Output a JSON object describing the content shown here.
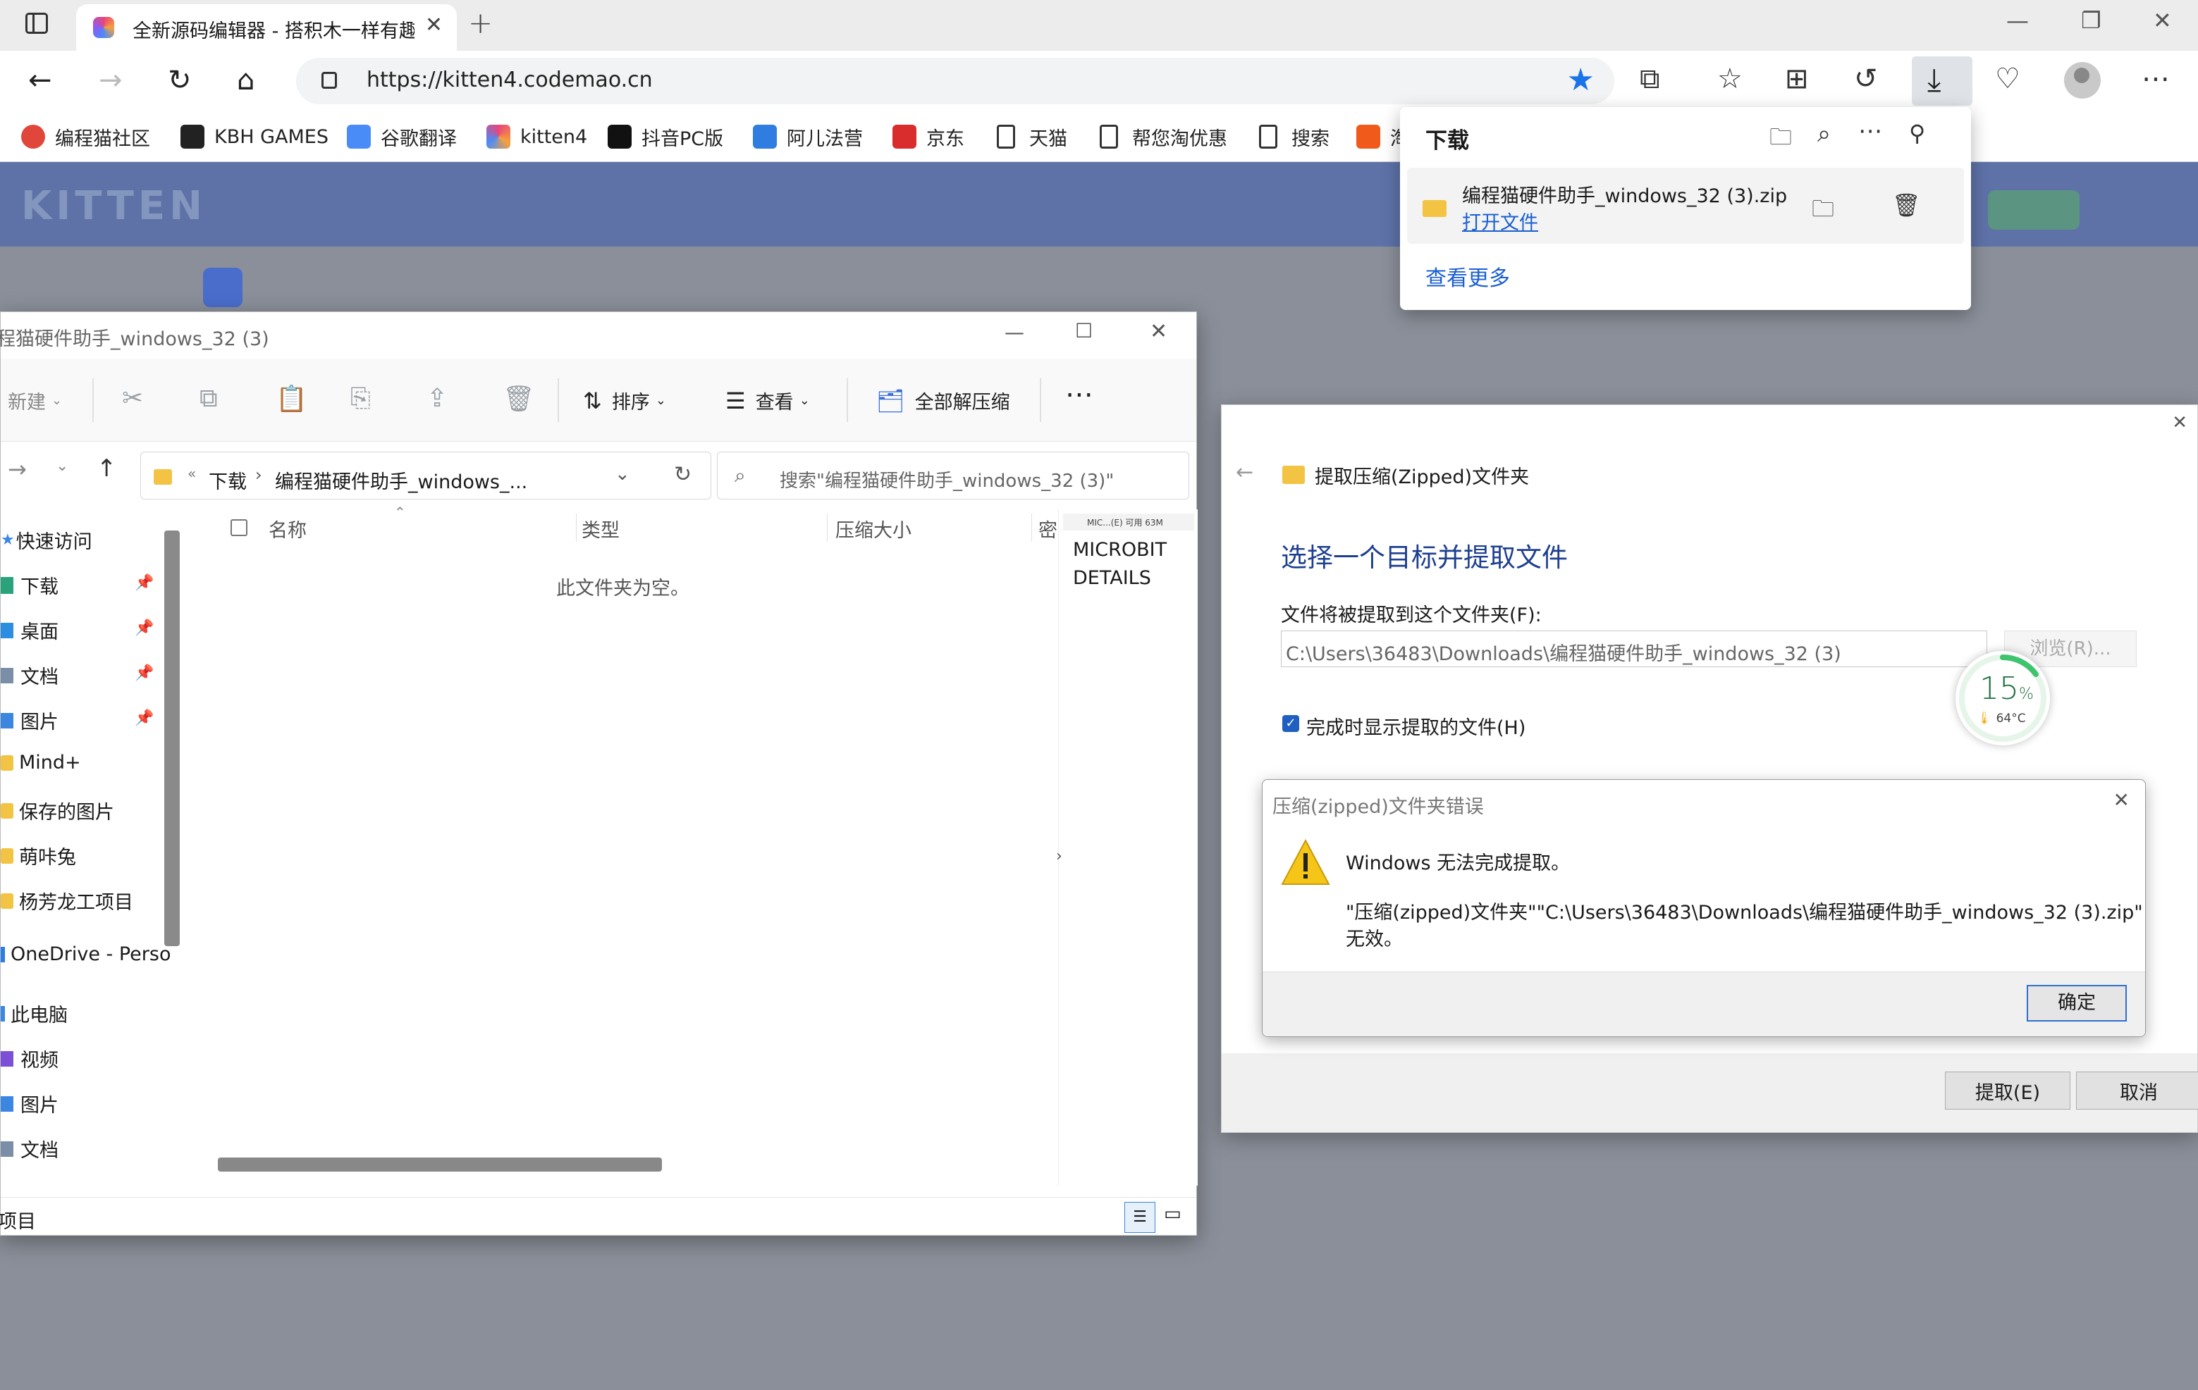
{
  "browser": {
    "tab_title": "全新源码编辑器 - 搭积木一样有趣",
    "url": "https://kitten4.codemao.cn",
    "bookmarks": [
      {
        "label": "编程猫社区",
        "color": "#e0463a"
      },
      {
        "label": "KBH GAMES",
        "color": "#222222"
      },
      {
        "label": "谷歌翻译",
        "color": "#4a8cf7"
      },
      {
        "label": "kitten4",
        "color": "#d946a8"
      },
      {
        "label": "抖音PC版",
        "color": "#111111"
      },
      {
        "label": "阿儿法营",
        "color": "#2f7de1"
      },
      {
        "label": "京东",
        "color": "#d92d2d"
      },
      {
        "label": "天猫",
        "color": "file"
      },
      {
        "label": "帮您淘优惠",
        "color": "file"
      },
      {
        "label": "搜索",
        "color": "file"
      },
      {
        "label": "淘",
        "color": "#f05a1a"
      }
    ]
  },
  "download_flyout": {
    "title": "下载",
    "file_name": "编程猫硬件助手_windows_32 (3).zip",
    "open_link": "打开文件",
    "see_more": "查看更多"
  },
  "explorer": {
    "title": "程猫硬件助手_windows_32 (3)",
    "toolbar": {
      "new": "新建",
      "sort": "排序",
      "view": "查看",
      "extract_all": "全部解压缩"
    },
    "breadcrumb": [
      "下载",
      "编程猫硬件助手_windows_..."
    ],
    "search_placeholder": "搜索\"编程猫硬件助手_windows_32 (3)\"",
    "sidebar": [
      {
        "label": "快速访问",
        "icon": "star-icon",
        "pinned": false
      },
      {
        "label": "下载",
        "icon": "download-icon",
        "pinned": true
      },
      {
        "label": "桌面",
        "icon": "desktop-icon",
        "pinned": true
      },
      {
        "label": "文档",
        "icon": "document-icon",
        "pinned": true
      },
      {
        "label": "图片",
        "icon": "picture-icon",
        "pinned": true
      },
      {
        "label": "Mind+",
        "icon": "folder-icon",
        "pinned": false
      },
      {
        "label": "保存的图片",
        "icon": "folder-icon",
        "pinned": false
      },
      {
        "label": "萌咔兔",
        "icon": "folder-icon",
        "pinned": false
      },
      {
        "label": "杨芳龙工项目",
        "icon": "folder-icon",
        "pinned": false
      },
      {
        "label": "OneDrive - Perso",
        "icon": "cloud-icon",
        "pinned": false
      },
      {
        "label": "此电脑",
        "icon": "computer-icon",
        "pinned": false
      },
      {
        "label": "视频",
        "icon": "video-icon",
        "pinned": false
      },
      {
        "label": "图片",
        "icon": "picture-icon",
        "pinned": false
      },
      {
        "label": "文档",
        "icon": "document-icon",
        "pinned": false
      }
    ],
    "columns": [
      "名称",
      "类型",
      "压缩大小",
      "密"
    ],
    "empty_message": "此文件夹为空。",
    "status": "项目",
    "preview": {
      "header": "MIC...(E) 可用 63M",
      "items": [
        "MICROBIT",
        "DETAILS"
      ]
    }
  },
  "wizard": {
    "header": "提取压缩(Zipped)文件夹",
    "heading": "选择一个目标并提取文件",
    "dest_label": "文件将被提取到这个文件夹(F):",
    "dest_value": "C:\\Users\\36483\\Downloads\\编程猫硬件助手_windows_32 (3)",
    "browse": "浏览(R)...",
    "show_files_label": "完成时显示提取的文件(H)",
    "show_files_checked": true,
    "extract_button": "提取(E)",
    "cancel_button": "取消"
  },
  "error_dialog": {
    "title": "压缩(zipped)文件夹错误",
    "main_message": "Windows 无法完成提取。",
    "detail_line1": "\"压缩(zipped)文件夹\"\"C:\\Users\\36483\\Downloads\\编程猫硬件助手_windows_32 (3).zip\"",
    "detail_line2": "无效。",
    "ok_button": "确定"
  },
  "temp_widget": {
    "percent": "15",
    "percent_sign": "%",
    "temperature": "64°C",
    "progress": 0.15
  }
}
